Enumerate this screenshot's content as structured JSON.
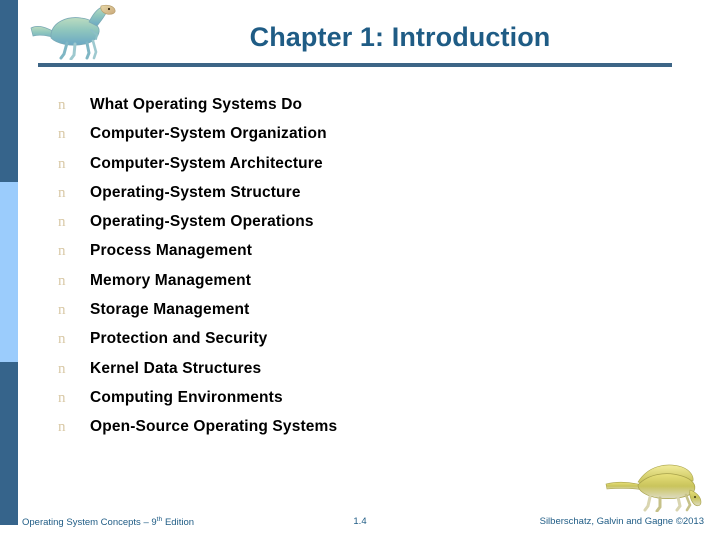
{
  "slide": {
    "title": "Chapter 1: Introduction",
    "accent_dark_blue": "#36648B",
    "accent_light_blue": "#9BCCFC",
    "title_color": "#1F5C85",
    "bullet_color": "#D9C9A6",
    "logo_icon": "dinosaur-icon",
    "footer_icon": "dinosaur-icon"
  },
  "bullets": [
    {
      "marker": "n",
      "label": "What Operating Systems Do"
    },
    {
      "marker": "n",
      "label": "Computer-System Organization"
    },
    {
      "marker": "n",
      "label": "Computer-System Architecture"
    },
    {
      "marker": "n",
      "label": "Operating-System Structure"
    },
    {
      "marker": "n",
      "label": "Operating-System Operations"
    },
    {
      "marker": "n",
      "label": "Process Management"
    },
    {
      "marker": "n",
      "label": "Memory Management"
    },
    {
      "marker": "n",
      "label": "Storage Management"
    },
    {
      "marker": "n",
      "label": "Protection and Security"
    },
    {
      "marker": "n",
      "label": "Kernel Data Structures"
    },
    {
      "marker": "n",
      "label": "Computing Environments"
    },
    {
      "marker": "n",
      "label": "Open-Source Operating Systems"
    }
  ],
  "footer": {
    "left_main": "Operating System Concepts – 9",
    "left_sup": "th",
    "left_tail": " Edition",
    "page_number": "1.4",
    "right": "Silberschatz, Galvin and Gagne ©2013"
  }
}
